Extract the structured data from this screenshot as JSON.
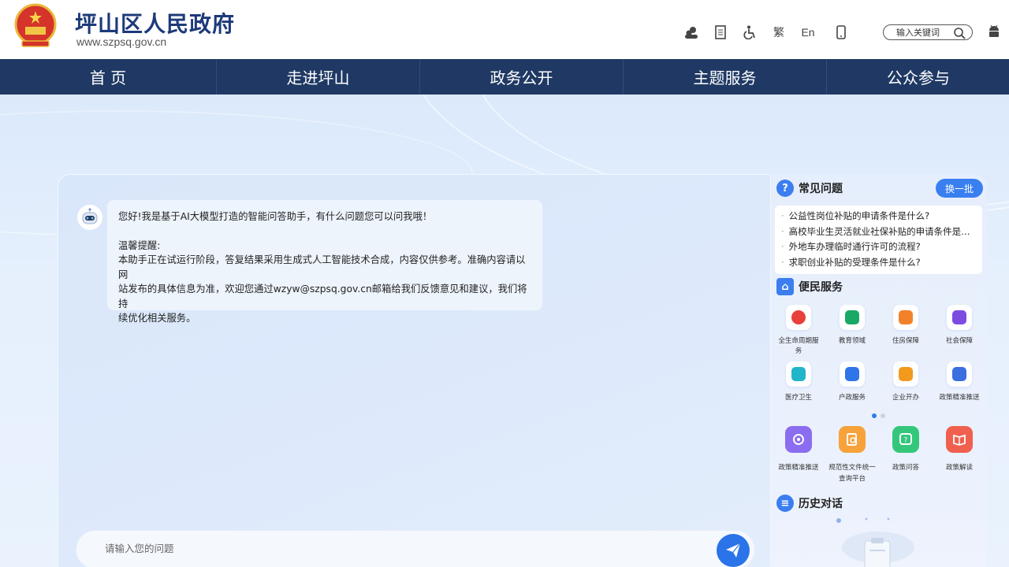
{
  "header": {
    "title": "坪山区人民政府",
    "url": "www.szpsq.gov.cn",
    "tools": [
      "users-icon",
      "document-icon",
      "accessibility-icon",
      "繁",
      "En",
      "mobile-icon"
    ],
    "traditional_label": "繁",
    "english_label": "En",
    "search_placeholder": "输入关键词"
  },
  "nav": {
    "items": [
      "首 页",
      "走进坪山",
      "政务公开",
      "主题服务",
      "公众参与"
    ]
  },
  "chat": {
    "greeting": "您好!我是基于AI大模型打造的智能问答助手，有什么问题您可以问我哦！",
    "reminder_title": "温馨提醒:",
    "reminder_line1": "本助手正在试运行阶段，答复结果采用生成式人工智能技术合成，内容仅供参考。准确内容请以网",
    "reminder_line2": "站发布的具体信息为准，欢迎您通过wzyw@szpsq.gov.cn邮箱给我们反馈意见和建议，我们将持",
    "reminder_line3": "续优化相关服务。",
    "input_placeholder": "请输入您的问题"
  },
  "faq": {
    "title": "常见问题",
    "refresh_label": "换一批",
    "items": [
      "公益性岗位补贴的申请条件是什么?",
      "高校毕业生灵活就业社保补贴的申请条件是什么?",
      "外地车办理临时通行许可的流程?",
      "求职创业补贴的受理条件是什么?"
    ]
  },
  "services": {
    "title": "便民服务",
    "items": [
      {
        "label": "全生命周期服务",
        "color": "#e8413c"
      },
      {
        "label": "教育领域",
        "color": "#1aa867"
      },
      {
        "label": "住房保障",
        "color": "#f2822a"
      },
      {
        "label": "社会保障",
        "color": "#7c4ce0"
      },
      {
        "label": "医疗卫生",
        "color": "#21b5c9"
      },
      {
        "label": "户政服务",
        "color": "#2f74e8"
      },
      {
        "label": "企业开办",
        "color": "#f29a1e"
      },
      {
        "label": "政策精准推送",
        "color": "#3b6fe0"
      }
    ],
    "tools": [
      {
        "label": "政策精准推送",
        "color": "#8a6df0"
      },
      {
        "label": "规范性文件统一查询平台",
        "color": "#f7a23b"
      },
      {
        "label": "政策问答",
        "color": "#34c77b"
      },
      {
        "label": "政策解读",
        "color": "#f0604f"
      }
    ]
  },
  "history": {
    "title": "历史对话"
  }
}
